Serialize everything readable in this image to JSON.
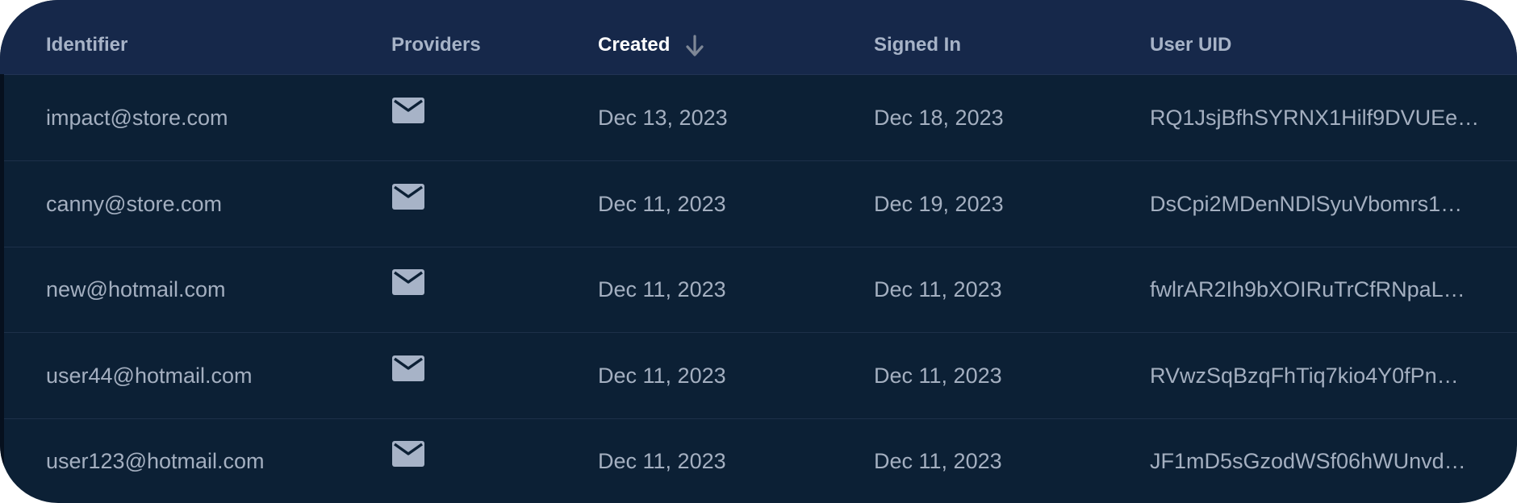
{
  "table": {
    "columns": {
      "identifier": "Identifier",
      "providers": "Providers",
      "created": "Created",
      "signed_in": "Signed In",
      "user_uid": "User UID"
    },
    "sort": {
      "column": "created",
      "direction": "descending",
      "icon": "arrow-down-icon"
    },
    "rows": [
      {
        "identifier": "impact@store.com",
        "provider_icon": "email-icon",
        "created": "Dec 13, 2023",
        "signed_in": "Dec 18, 2023",
        "user_uid": "RQ1JsjBfhSYRNX1Hilf9DVUEe…"
      },
      {
        "identifier": "canny@store.com",
        "provider_icon": "email-icon",
        "created": "Dec 11, 2023",
        "signed_in": "Dec 19, 2023",
        "user_uid": "DsCpi2MDenNDlSyuVbomrs1…"
      },
      {
        "identifier": "new@hotmail.com",
        "provider_icon": "email-icon",
        "created": "Dec 11, 2023",
        "signed_in": "Dec 11, 2023",
        "user_uid": "fwlrAR2Ih9bXOIRuTrCfRNpaL…"
      },
      {
        "identifier": "user44@hotmail.com",
        "provider_icon": "email-icon",
        "created": "Dec 11, 2023",
        "signed_in": "Dec 11, 2023",
        "user_uid": "RVwzSqBzqFhTiq7kio4Y0fPn…"
      },
      {
        "identifier": "user123@hotmail.com",
        "provider_icon": "email-icon",
        "created": "Dec 11, 2023",
        "signed_in": "Dec 11, 2023",
        "user_uid": "JF1mD5sGzodWSf06hWUnvd…"
      }
    ]
  },
  "colors": {
    "header_bg": "#16284a",
    "row_bg": "#0c2035",
    "text": "#a4afc0",
    "active_header": "#ffffff",
    "icon": "#a7b3c7"
  }
}
